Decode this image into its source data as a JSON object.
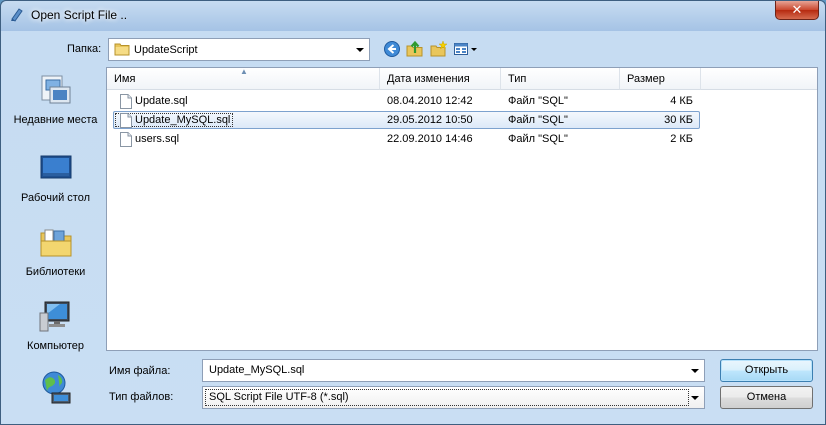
{
  "window": {
    "title": "Open Script File ..",
    "close_label": "✕"
  },
  "toolbar": {
    "folder_label": "Папка:",
    "folder_value": "UpdateScript",
    "icons": [
      "back-icon",
      "up-folder-icon",
      "new-folder-icon",
      "views-menu-icon"
    ]
  },
  "places": [
    {
      "label": "Недавние места",
      "icon": "recent-places-icon"
    },
    {
      "label": "Рабочий стол",
      "icon": "desktop-icon"
    },
    {
      "label": "Библиотеки",
      "icon": "libraries-icon"
    },
    {
      "label": "Компьютер",
      "icon": "computer-icon"
    },
    {
      "label": "",
      "icon": "network-icon"
    }
  ],
  "columns": {
    "name": "Имя",
    "date": "Дата изменения",
    "type": "Тип",
    "size": "Размер"
  },
  "files": [
    {
      "name": "Update.sql",
      "date": "08.04.2010 12:42",
      "type": "Файл \"SQL\"",
      "size": "4 КБ",
      "selected": false
    },
    {
      "name": "Update_MySQL.sql",
      "date": "29.05.2012 10:50",
      "type": "Файл \"SQL\"",
      "size": "30 КБ",
      "selected": true
    },
    {
      "name": "users.sql",
      "date": "22.09.2010 14:46",
      "type": "Файл \"SQL\"",
      "size": "2 КБ",
      "selected": false
    }
  ],
  "bottom": {
    "filename_label": "Имя файла:",
    "filename_value": "Update_MySQL.sql",
    "filetype_label": "Тип файлов:",
    "filetype_value": "SQL Script File UTF-8 (*.sql)",
    "open_button": "Открыть",
    "cancel_button": "Отмена"
  },
  "colors": {
    "selection": "#dce9f8",
    "selection_border": "#7da2ce",
    "window_frame": "#c6dcf2"
  }
}
